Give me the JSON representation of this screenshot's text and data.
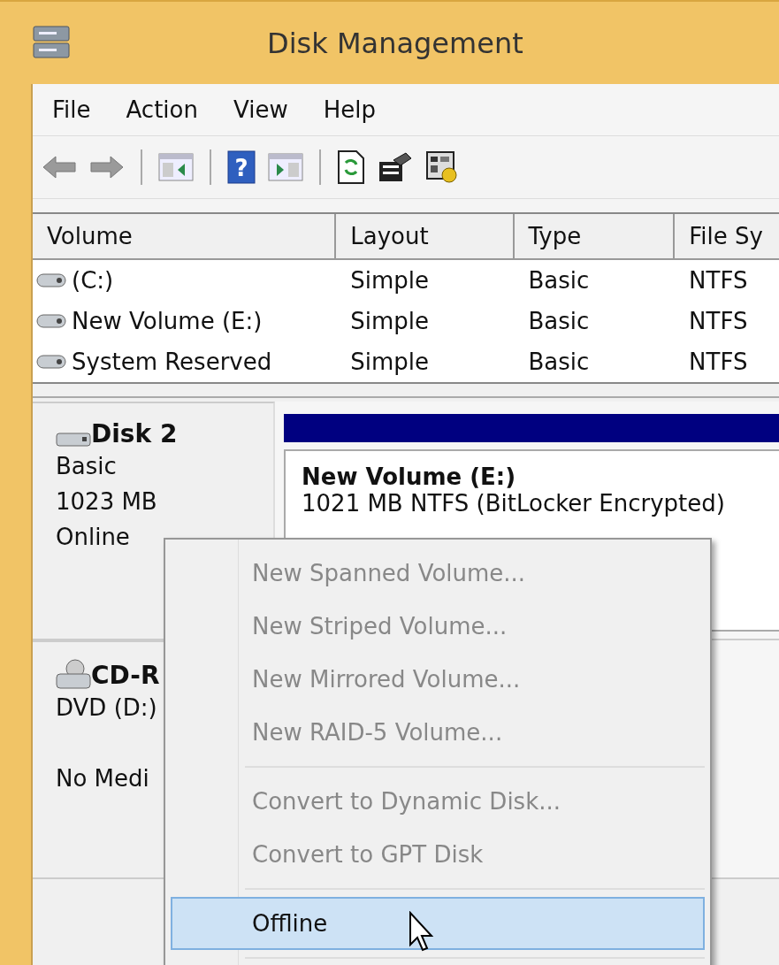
{
  "window": {
    "title": "Disk Management"
  },
  "menu": [
    "File",
    "Action",
    "View",
    "Help"
  ],
  "toolbar": {
    "help_glyph": "?"
  },
  "volume_list": {
    "columns": [
      "Volume",
      "Layout",
      "Type",
      "File Sy"
    ],
    "rows": [
      {
        "volume": "(C:)",
        "layout": "Simple",
        "type": "Basic",
        "file_system": "NTFS"
      },
      {
        "volume": "New Volume (E:)",
        "layout": "Simple",
        "type": "Basic",
        "file_system": "NTFS"
      },
      {
        "volume": "System Reserved",
        "layout": "Simple",
        "type": "Basic",
        "file_system": "NTFS"
      }
    ]
  },
  "disks": [
    {
      "kind": "disk",
      "name": "Disk 2",
      "lines": [
        "Basic",
        "1023 MB",
        "Online"
      ],
      "partition": {
        "name": "New Volume  (E:)",
        "detail": "1021 MB NTFS (BitLocker Encrypted)"
      }
    },
    {
      "kind": "cdrom",
      "name": "CD-R",
      "lines": [
        "DVD (D:)"
      ],
      "note": "No Medi"
    }
  ],
  "context_menu": [
    {
      "kind": "item",
      "label": "New Spanned Volume...",
      "disabled": true,
      "selected": false
    },
    {
      "kind": "item",
      "label": "New Striped Volume...",
      "disabled": true,
      "selected": false
    },
    {
      "kind": "item",
      "label": "New Mirrored Volume...",
      "disabled": true,
      "selected": false
    },
    {
      "kind": "item",
      "label": "New RAID-5 Volume...",
      "disabled": true,
      "selected": false
    },
    {
      "kind": "separator"
    },
    {
      "kind": "item",
      "label": "Convert to Dynamic Disk...",
      "disabled": true,
      "selected": false
    },
    {
      "kind": "item",
      "label": "Convert to GPT Disk",
      "disabled": true,
      "selected": false
    },
    {
      "kind": "separator"
    },
    {
      "kind": "item",
      "label": "Offline",
      "disabled": false,
      "selected": true
    },
    {
      "kind": "separator"
    }
  ]
}
